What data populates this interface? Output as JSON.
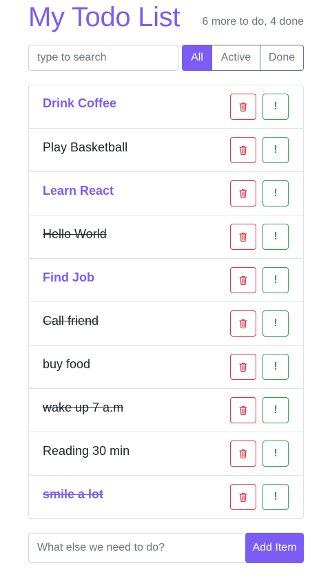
{
  "header": {
    "title": "My Todo List",
    "counter": "6 more to do, 4 done"
  },
  "search": {
    "placeholder": "type to search",
    "value": ""
  },
  "filters": [
    {
      "label": "All",
      "active": true
    },
    {
      "label": "Active",
      "active": false
    },
    {
      "label": "Done",
      "active": false
    }
  ],
  "todos": [
    {
      "label": "Drink Coffee",
      "important": true,
      "done": false
    },
    {
      "label": "Play Basketball",
      "important": false,
      "done": false
    },
    {
      "label": "Learn React",
      "important": true,
      "done": false
    },
    {
      "label": "Hello World",
      "important": false,
      "done": true
    },
    {
      "label": "Find Job",
      "important": true,
      "done": false
    },
    {
      "label": "Call friend",
      "important": false,
      "done": true
    },
    {
      "label": "buy food",
      "important": false,
      "done": false
    },
    {
      "label": "wake up 7 a.m",
      "important": false,
      "done": true
    },
    {
      "label": "Reading 30 min",
      "important": false,
      "done": false
    },
    {
      "label": "smile a lot",
      "important": true,
      "done": true
    }
  ],
  "item_buttons": {
    "delete_icon": "trash-icon",
    "important_icon": "exclamation-icon",
    "important_glyph": "!"
  },
  "add_form": {
    "placeholder": "What else we need to do?",
    "value": "",
    "button_label": "Add Item"
  },
  "colors": {
    "accent": "#7b5cf5",
    "danger": "#dc3545",
    "success": "#28a745",
    "muted": "#6c757d",
    "border": "#dee2e6"
  }
}
